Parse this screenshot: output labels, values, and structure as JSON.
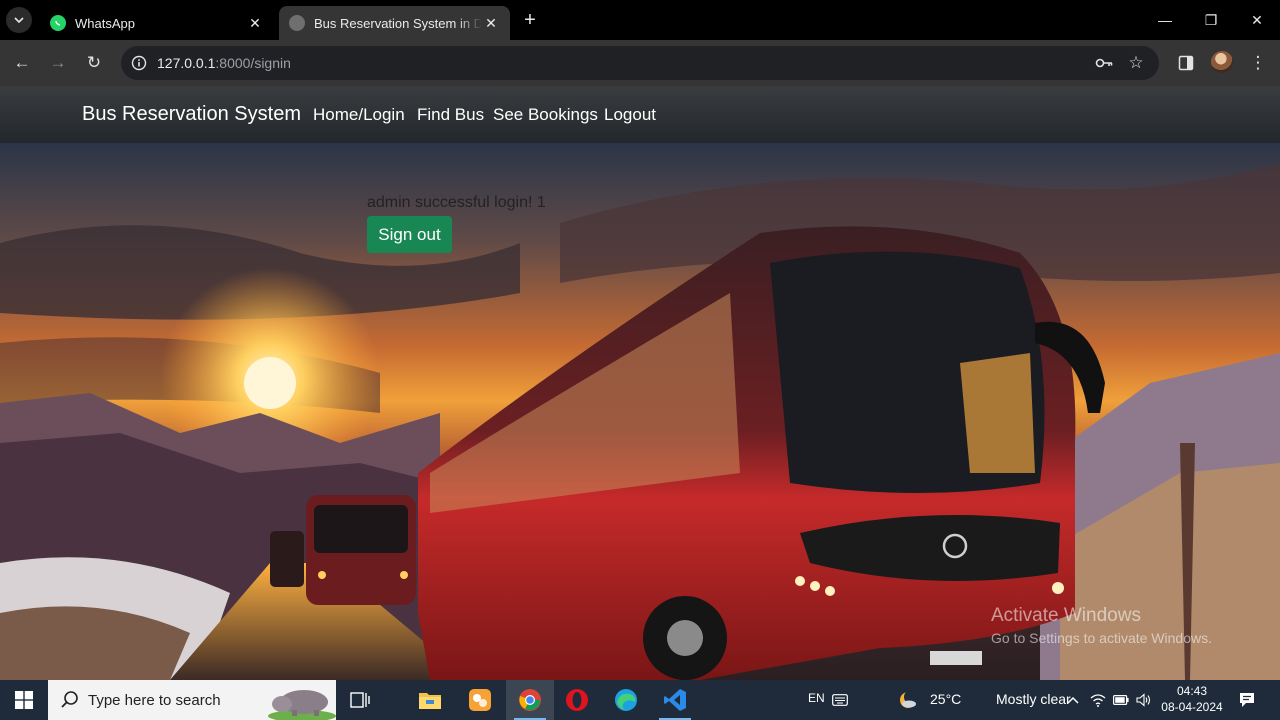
{
  "browser": {
    "tabs": [
      {
        "title": "WhatsApp",
        "favicon": "whatsapp-icon"
      },
      {
        "title": "Bus Reservation System in Django",
        "favicon": "globe-icon"
      }
    ],
    "url_host": "127.0.0.1",
    "url_path": ":8000/signin"
  },
  "navbar": {
    "brand": "Bus Reservation System",
    "links": [
      "Home/Login",
      "Find Bus",
      "See Bookings",
      "Logout"
    ]
  },
  "main": {
    "login_message": "admin successful login! 1",
    "signout_label": "Sign out"
  },
  "watermark": {
    "line1": "Activate Windows",
    "line2": "Go to Settings to activate Windows."
  },
  "taskbar": {
    "search_placeholder": "Type here to search",
    "language": "EN",
    "weather_temp": "25°C",
    "weather_text": "Mostly clear",
    "time": "04:43",
    "date": "08-04-2024"
  },
  "colors": {
    "signout_button": "#198754",
    "navbar_bg": "#23272b",
    "taskbar_bg": "#1f2b3a"
  }
}
